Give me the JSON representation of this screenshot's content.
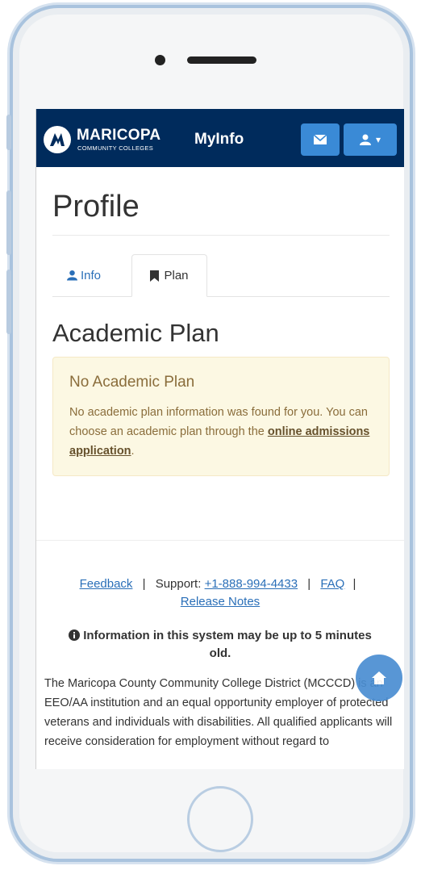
{
  "navbar": {
    "brand_main": "MARICOPA",
    "brand_sub": "COMMUNITY COLLEGES",
    "app_name": "MyInfo",
    "mail_icon": "envelope-icon",
    "user_icon": "user-icon",
    "user_caret": "▾",
    "background": "#002b5c",
    "button_color": "#3a8ad6"
  },
  "page": {
    "title": "Profile"
  },
  "tabs": [
    {
      "label": "Info",
      "icon": "user-icon",
      "active": false
    },
    {
      "label": "Plan",
      "icon": "bookmark-icon",
      "active": true
    }
  ],
  "section": {
    "title": "Academic Plan"
  },
  "alert": {
    "title": "No Academic Plan",
    "body_text": "No academic plan information was found for you. You can choose an academic plan through the ",
    "link_text": "online admissions application",
    "after_link": ".",
    "background": "#fcf8e3"
  },
  "footer": {
    "feedback_label": "Feedback",
    "sep1": "|",
    "support_label": "Support:",
    "phone": "+1-888-994-4433",
    "sep2": "|",
    "faq_label": "FAQ",
    "sep3": "|",
    "release_notes_label": "Release Notes",
    "notice_icon": "info-circle-icon",
    "notice_text": "Information in this system may be up to 5 minutes old.",
    "eeo_text": "The Maricopa County Community College District (MCCCD) is an EEO/AA institution and an equal opportunity employer of protected veterans and individuals with disabilities. All qualified applicants will receive consideration for employment without regard to"
  },
  "fab": {
    "icon": "home-icon"
  }
}
